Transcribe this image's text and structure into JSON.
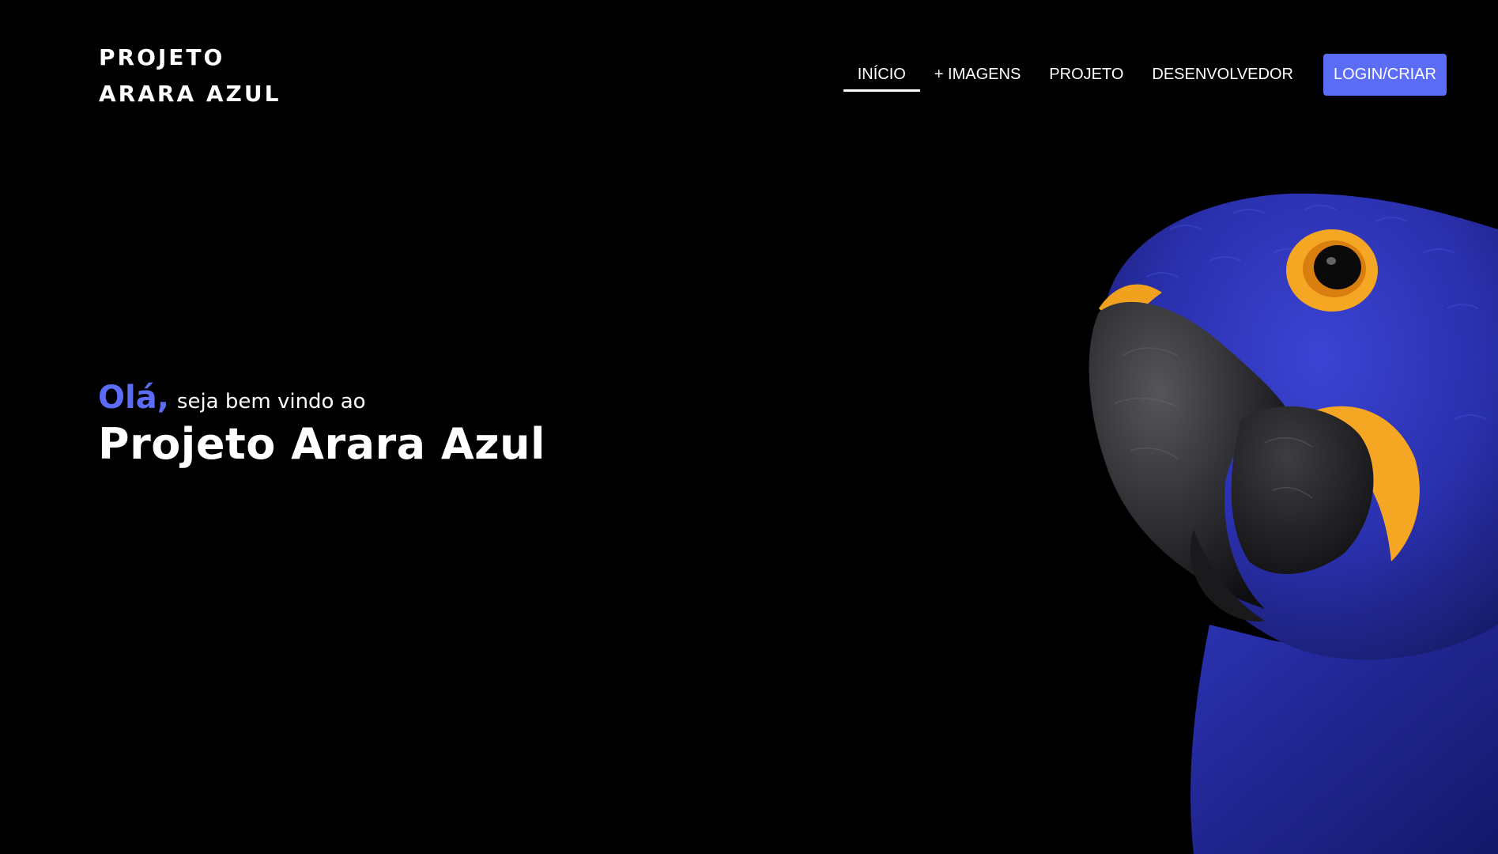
{
  "header": {
    "logo": {
      "line1": "PROJETO",
      "line2": "ARARA AZUL"
    },
    "nav": {
      "items": [
        {
          "label": "INÍCIO",
          "active": true
        },
        {
          "label": "+ IMAGENS",
          "active": false
        },
        {
          "label": "PROJETO",
          "active": false
        },
        {
          "label": "DESENVOLVEDOR",
          "active": false
        }
      ],
      "login_label": "LOGIN/CRIAR"
    }
  },
  "hero": {
    "greeting_accent": "Olá,",
    "greeting_text": "seja bem vindo ao",
    "title": "Projeto Arara Azul",
    "image_subject": "hyacinth-macaw-icon"
  },
  "colors": {
    "background": "#000000",
    "accent": "#5b6cf7",
    "text": "#ffffff",
    "macaw_blue": "#2f35b8",
    "macaw_yellow": "#f5a623",
    "beak": "#2b2b2e"
  }
}
